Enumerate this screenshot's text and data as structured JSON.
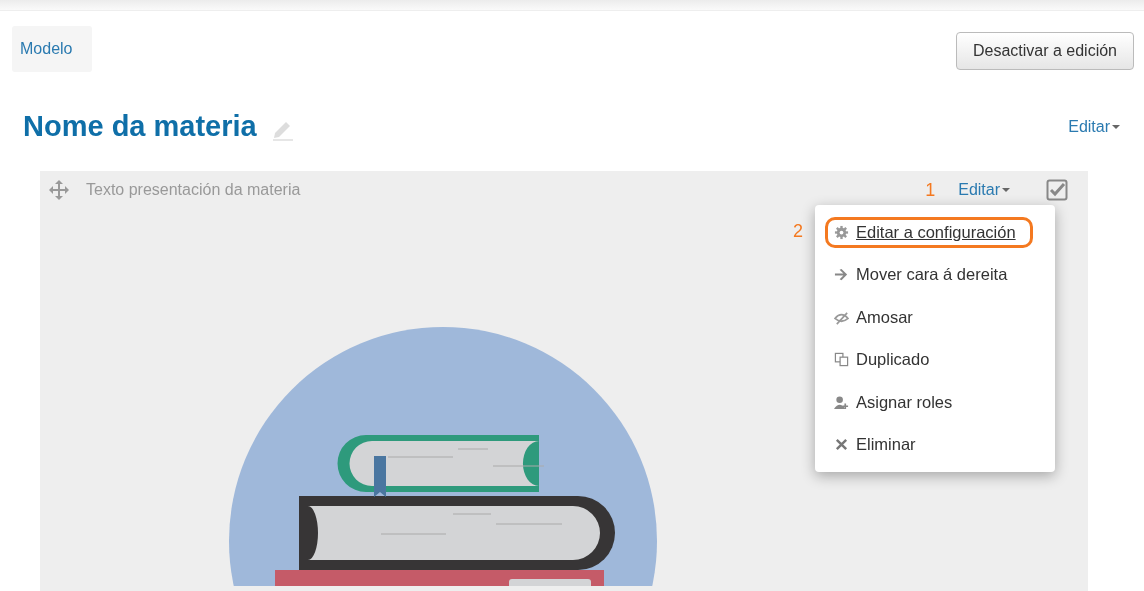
{
  "breadcrumb": {
    "label": "Modelo"
  },
  "edit_mode_button": {
    "label": "Desactivar a edición"
  },
  "course": {
    "title": "Nome da materia",
    "edit_menu": {
      "label": "Editar"
    }
  },
  "section": {
    "title": "Texto presentación da materia",
    "edit_menu": {
      "label": "Editar",
      "callout": "1"
    },
    "checkbox": {
      "checked": true
    },
    "menu_items": [
      {
        "label": "Editar a configuración",
        "selected": true,
        "callout": "2"
      },
      {
        "label": "Mover cara á dereita",
        "selected": false
      },
      {
        "label": "Amosar",
        "selected": false
      },
      {
        "label": "Duplicado",
        "selected": false
      },
      {
        "label": "Asignar roles",
        "selected": false
      },
      {
        "label": "Eliminar",
        "selected": false
      }
    ]
  }
}
